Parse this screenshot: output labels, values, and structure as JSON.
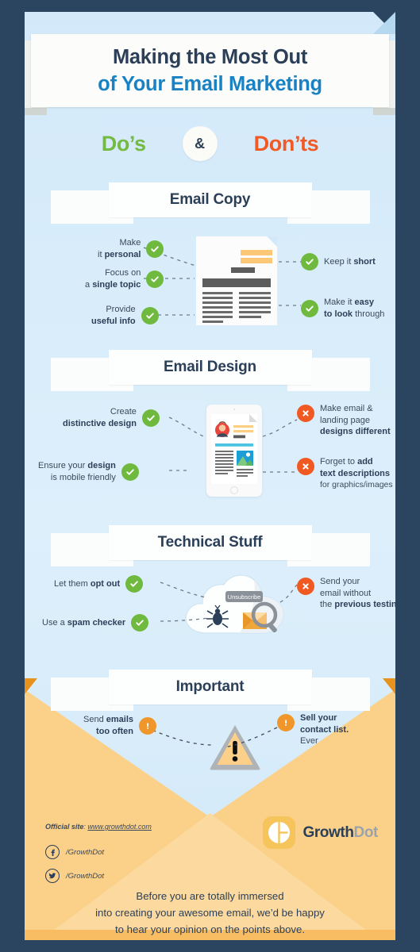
{
  "colors": {
    "background": "#2b4560",
    "paper": "#d8ecfa",
    "title_dark": "#2b3f58",
    "title_blue": "#1982c4",
    "dos_green": "#74bb44",
    "donts_orange": "#f15a24",
    "check_green": "#6fba3e",
    "cross_orange": "#f05a22",
    "warn_orange": "#f0962a",
    "envelope": "#fbd089",
    "envelope_shine": "#fcd99e",
    "envelope_corner": "#e8921e",
    "logo_yellow": "#f5c55c"
  },
  "header": {
    "title_line1": "Making the Most Out",
    "title_line2": "of Your Email Marketing",
    "dos_label": "Do’s",
    "ampersand": "&",
    "donts_label": "Don’ts"
  },
  "sections": [
    {
      "id": "email-copy",
      "title": "Email Copy",
      "illustration": "document-icon",
      "left_items": [
        {
          "badge": "check",
          "lines": [
            {
              "text": "Make",
              "bold": false
            },
            {
              "text": "it ",
              "bold": false,
              "strong": "personal"
            }
          ]
        },
        {
          "badge": "check",
          "lines": [
            {
              "text": "Focus on",
              "bold": false
            },
            {
              "text": "a ",
              "bold": false,
              "strong": "single topic"
            }
          ]
        },
        {
          "badge": "check",
          "lines": [
            {
              "text": "Provide",
              "bold": false
            },
            {
              "text": "",
              "bold": false,
              "strong": "useful info"
            }
          ]
        }
      ],
      "right_items": [
        {
          "badge": "check",
          "lines": [
            {
              "text": "Keep it ",
              "strong": "short"
            }
          ]
        },
        {
          "badge": "check",
          "lines": [
            {
              "text": "Make it ",
              "strong": "easy"
            },
            {
              "strong": "to look",
              "tail": " through"
            }
          ]
        }
      ]
    },
    {
      "id": "email-design",
      "title": "Email Design",
      "illustration": "tablet-icon",
      "left_items": [
        {
          "badge": "check",
          "lines": [
            {
              "text": "Create"
            },
            {
              "strong": "distinctive design"
            }
          ]
        },
        {
          "badge": "check",
          "lines": [
            {
              "text": "Ensure your ",
              "strong": "design"
            },
            {
              "text": "is mobile friendly"
            }
          ]
        }
      ],
      "right_items": [
        {
          "badge": "cross",
          "lines": [
            {
              "text": "Make email &"
            },
            {
              "text": "landing page"
            },
            {
              "strong": "designs different"
            }
          ]
        },
        {
          "badge": "cross",
          "lines": [
            {
              "text": "Forget to ",
              "strong": "add"
            },
            {
              "strong": "text descriptions"
            },
            {
              "text": "for graphics/images",
              "small": true
            }
          ]
        }
      ]
    },
    {
      "id": "technical-stuff",
      "title": "Technical Stuff",
      "illustration": "cloud-icon",
      "illustration_label": "Unsubscribe",
      "left_items": [
        {
          "badge": "check",
          "lines": [
            {
              "text": "Let them ",
              "strong": "opt out"
            }
          ]
        },
        {
          "badge": "check",
          "lines": [
            {
              "text": "Use a ",
              "strong": "spam checker"
            }
          ]
        }
      ],
      "right_items": [
        {
          "badge": "cross",
          "lines": [
            {
              "text": "Send your"
            },
            {
              "text": "email without"
            },
            {
              "text": "the ",
              "strong": "previous testing"
            }
          ]
        }
      ]
    },
    {
      "id": "important",
      "title": "Important",
      "illustration": "warning-triangle-icon",
      "left_items": [
        {
          "badge": "warn",
          "lines": [
            {
              "text": "Send ",
              "strong": "emails"
            },
            {
              "strong": "too often"
            }
          ]
        }
      ],
      "right_items": [
        {
          "badge": "warn",
          "lines": [
            {
              "strong": "Sell your"
            },
            {
              "strong": "contact list."
            },
            {
              "text": "Ever"
            }
          ]
        }
      ]
    }
  ],
  "footer": {
    "official_site_label": "Official site",
    "official_site_sep": ": ",
    "official_site_url": "www.growthdot.com",
    "social": [
      {
        "icon": "facebook-icon",
        "handle": "/GrowthDot"
      },
      {
        "icon": "twitter-icon",
        "handle": "/GrowthDot"
      }
    ],
    "logo_name_1": "Growth",
    "logo_name_2": "Dot",
    "closing_line1": "Before you are totally immersed",
    "closing_line2": "into creating your awesome email, we’d be happy",
    "closing_line3": "to hear your opinion on the points above."
  }
}
